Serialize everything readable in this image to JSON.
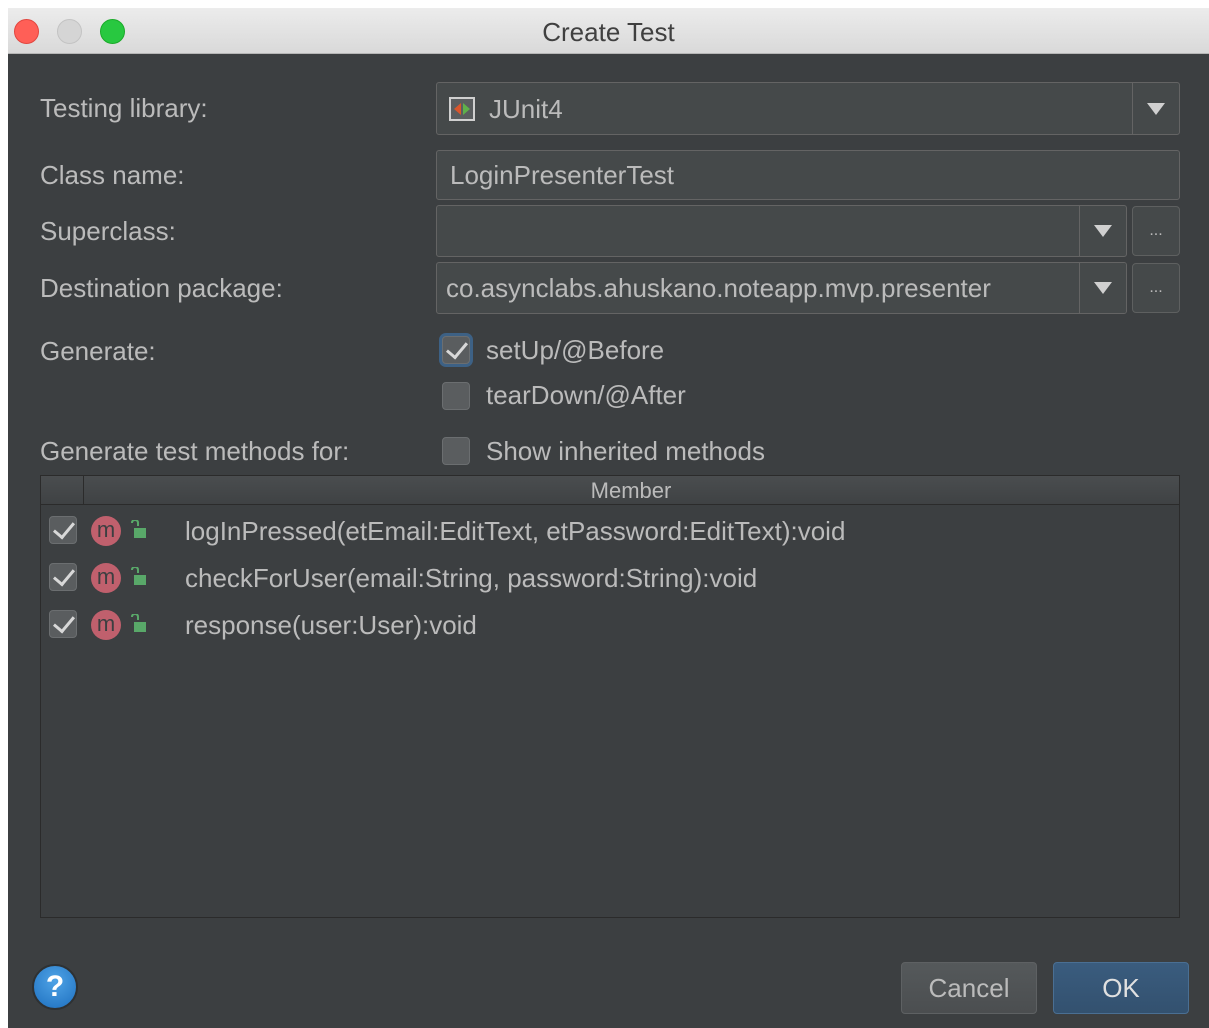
{
  "window": {
    "title": "Create Test"
  },
  "form": {
    "testing_library_label": "Testing library:",
    "testing_library_value": "JUnit4",
    "class_name_label": "Class name:",
    "class_name_value": "LoginPresenterTest",
    "superclass_label": "Superclass:",
    "superclass_value": "",
    "destination_package_label": "Destination package:",
    "destination_package_value": "co.asynclabs.ahuskano.noteapp.mvp.presenter",
    "browse_label": "...",
    "generate_label": "Generate:",
    "generate_options": [
      {
        "label": "setUp/@Before",
        "checked": true
      },
      {
        "label": "tearDown/@After",
        "checked": false
      }
    ],
    "methods_label": "Generate test methods for:",
    "show_inherited_label": "Show inherited methods",
    "show_inherited_checked": false
  },
  "table": {
    "column_header": "Member",
    "rows": [
      {
        "signature": "logInPressed(etEmail:EditText, etPassword:EditText):void",
        "checked": true,
        "icon": "m"
      },
      {
        "signature": "checkForUser(email:String, password:String):void",
        "checked": true,
        "icon": "m"
      },
      {
        "signature": "response(user:User):void",
        "checked": true,
        "icon": "m"
      }
    ]
  },
  "footer": {
    "help_glyph": "?",
    "cancel_label": "Cancel",
    "ok_label": "OK"
  },
  "colors": {
    "background": "#3c3f41",
    "field_background": "#45494a",
    "text": "#bbbbbb",
    "method_icon": "#c0606d",
    "lock_icon": "#59a869",
    "ok_button": "#365880"
  }
}
